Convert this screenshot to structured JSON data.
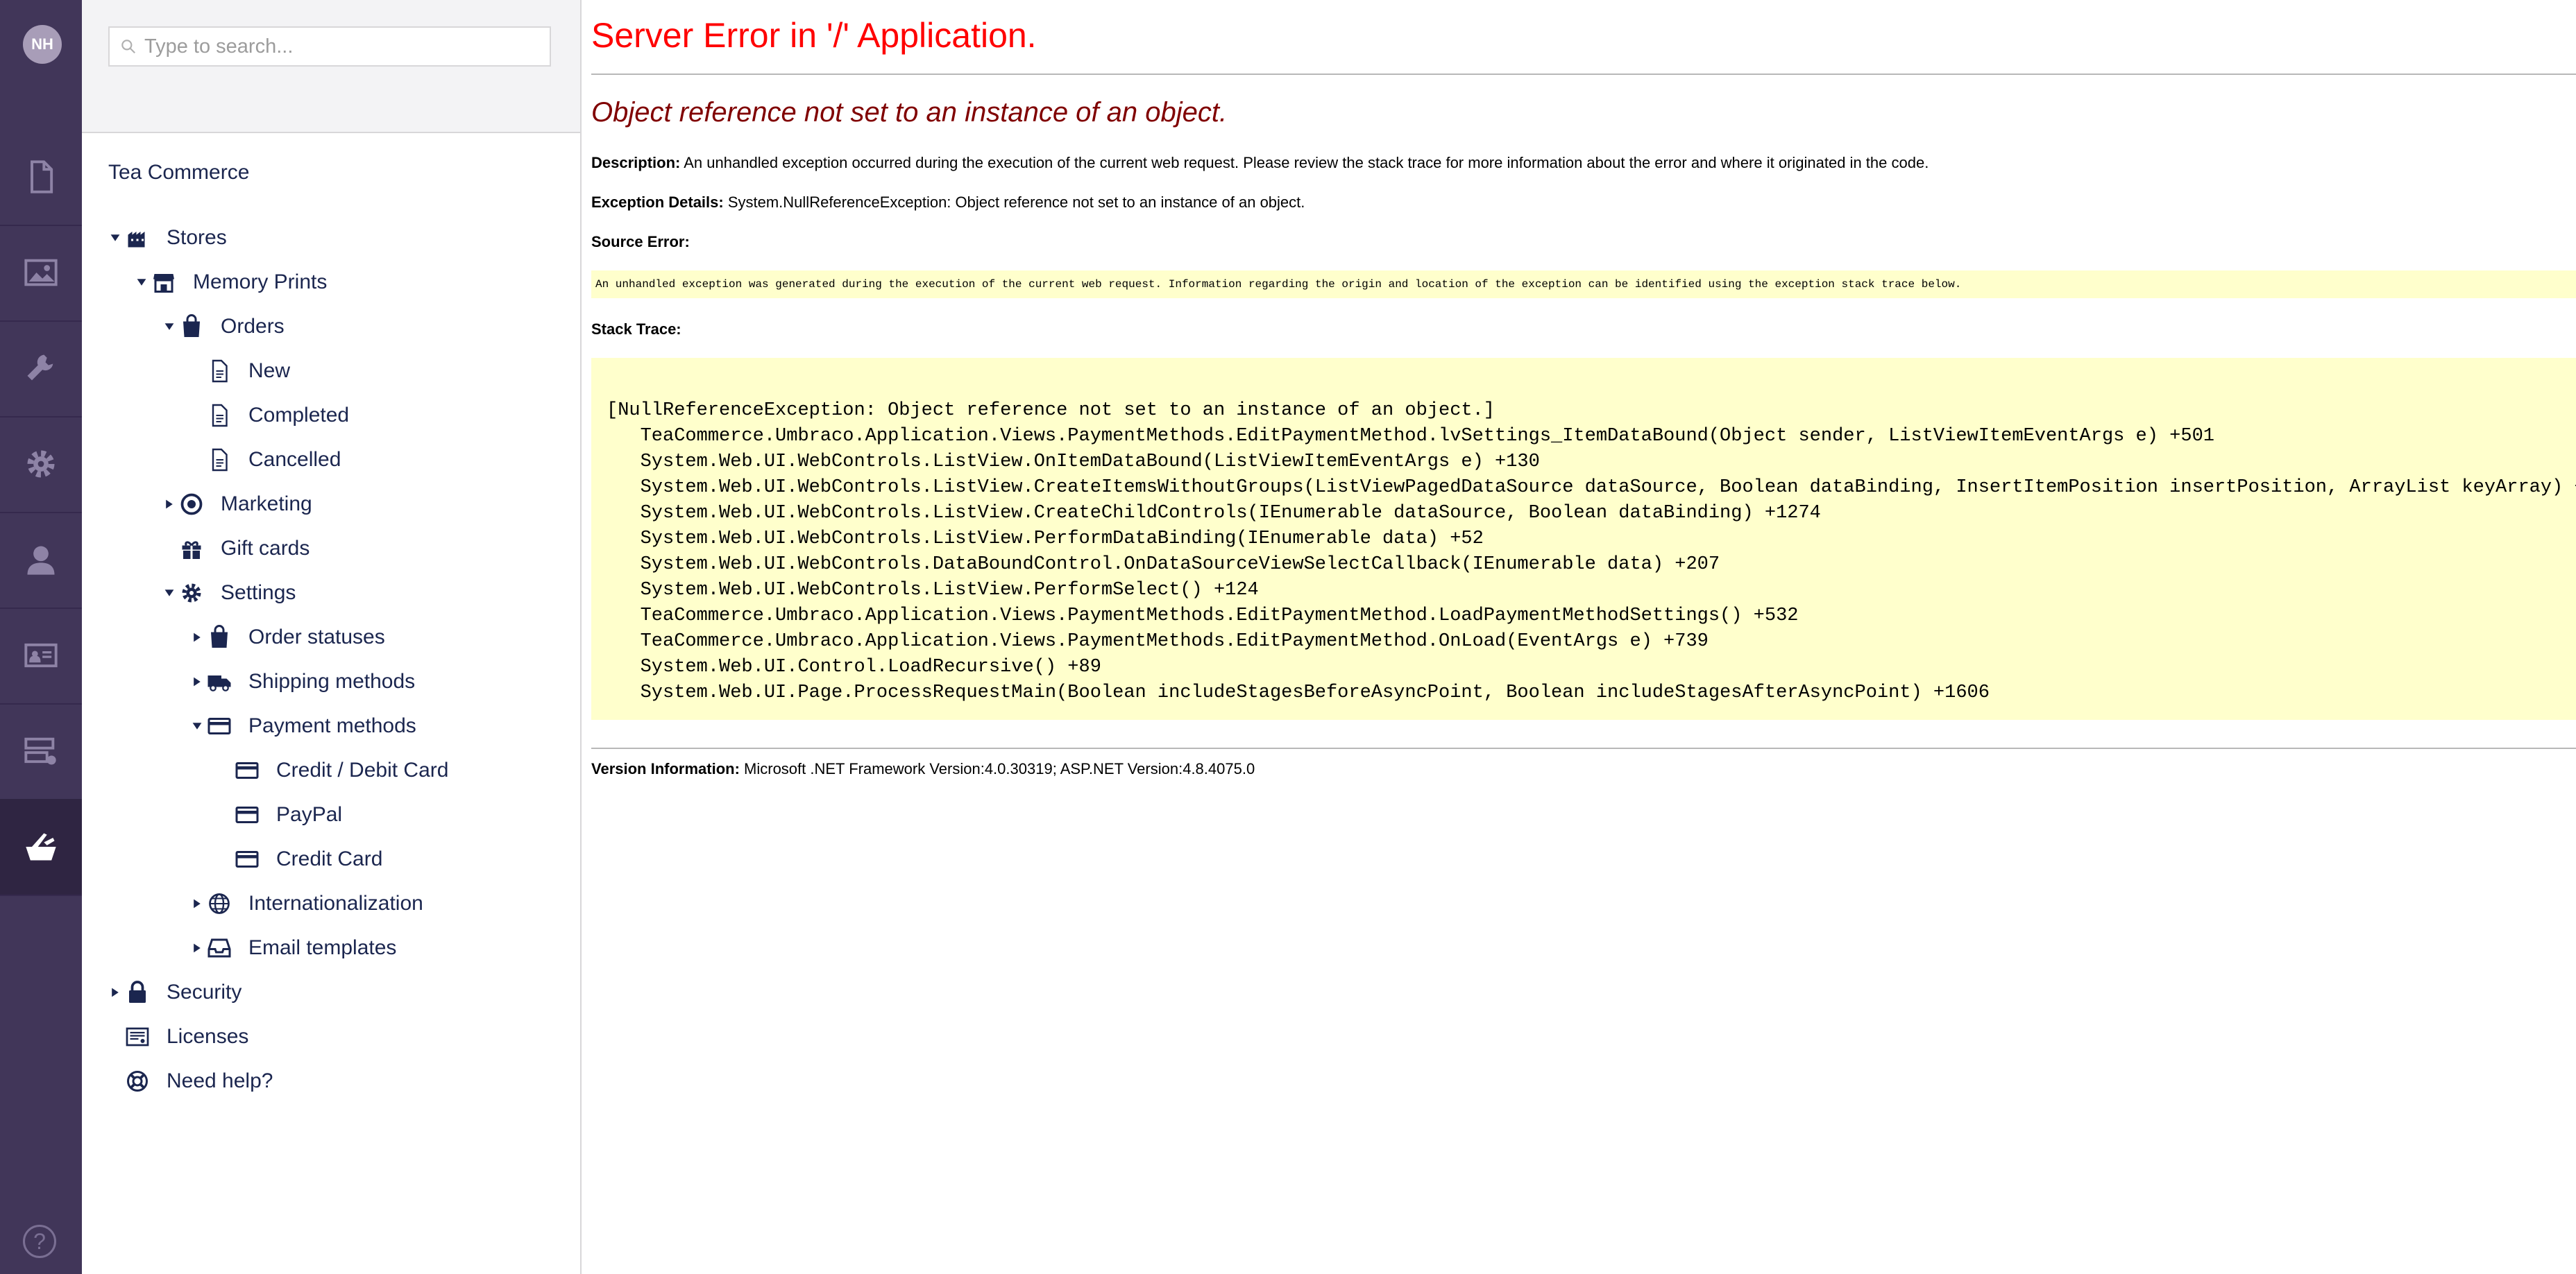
{
  "user": {
    "initials": "NH"
  },
  "rail": {
    "items": [
      "content-icon",
      "media-icon",
      "settings-wrench-icon",
      "gear-icon",
      "user-icon",
      "member-card-icon",
      "forms-icon",
      "tea-commerce-icon"
    ],
    "active": "tea-commerce-icon",
    "help_label": "?"
  },
  "search": {
    "placeholder": "Type to search..."
  },
  "tree": {
    "title": "Tea Commerce",
    "nodes": [
      {
        "label": "Stores",
        "icon": "stores-icon",
        "arrow": "expanded"
      },
      {
        "label": "Memory Prints",
        "icon": "store-icon",
        "arrow": "expanded"
      },
      {
        "label": "Orders",
        "icon": "shopping-bag-icon",
        "arrow": "expanded"
      },
      {
        "label": "New",
        "icon": "document-icon",
        "arrow": "none"
      },
      {
        "label": "Completed",
        "icon": "document-icon",
        "arrow": "none"
      },
      {
        "label": "Cancelled",
        "icon": "document-icon",
        "arrow": "none"
      },
      {
        "label": "Marketing",
        "icon": "target-icon",
        "arrow": "collapsed"
      },
      {
        "label": "Gift cards",
        "icon": "gift-icon",
        "arrow": "none"
      },
      {
        "label": "Settings",
        "icon": "gear-icon",
        "arrow": "expanded"
      },
      {
        "label": "Order statuses",
        "icon": "shopping-bag-icon",
        "arrow": "collapsed"
      },
      {
        "label": "Shipping methods",
        "icon": "truck-icon",
        "arrow": "collapsed"
      },
      {
        "label": "Payment methods",
        "icon": "credit-card-icon",
        "arrow": "expanded"
      },
      {
        "label": "Credit / Debit Card",
        "icon": "credit-card-icon",
        "arrow": "none"
      },
      {
        "label": "PayPal",
        "icon": "credit-card-icon",
        "arrow": "none"
      },
      {
        "label": "Credit Card",
        "icon": "credit-card-icon",
        "arrow": "none"
      },
      {
        "label": "Internationalization",
        "icon": "globe-icon",
        "arrow": "collapsed"
      },
      {
        "label": "Email templates",
        "icon": "inbox-icon",
        "arrow": "collapsed"
      },
      {
        "label": "Security",
        "icon": "lock-icon",
        "arrow": "collapsed"
      },
      {
        "label": "Licenses",
        "icon": "license-icon",
        "arrow": "none"
      },
      {
        "label": "Need help?",
        "icon": "lifebuoy-icon",
        "arrow": "none"
      }
    ]
  },
  "error": {
    "title": "Server Error in '/' Application.",
    "subtitle": "Object reference not set to an instance of an object.",
    "description_label": "Description:",
    "description_text": " An unhandled exception occurred during the execution of the current web request. Please review the stack trace for more information about the error and where it originated in the code.",
    "exception_label": "Exception Details:",
    "exception_text": " System.NullReferenceException: Object reference not set to an instance of an object.",
    "source_label": "Source Error:",
    "source_text": "An unhandled exception was generated during the execution of the current web request. Information regarding the origin and location of the exception can be identified using the exception stack trace below.",
    "stack_label": "Stack Trace:",
    "stack_lines": [
      "[NullReferenceException: Object reference not set to an instance of an object.]",
      "   TeaCommerce.Umbraco.Application.Views.PaymentMethods.EditPaymentMethod.lvSettings_ItemDataBound(Object sender, ListViewItemEventArgs e) +501",
      "   System.Web.UI.WebControls.ListView.OnItemDataBound(ListViewItemEventArgs e) +130",
      "   System.Web.UI.WebControls.ListView.CreateItemsWithoutGroups(ListViewPagedDataSource dataSource, Boolean dataBinding, InsertItemPosition insertPosition, ArrayList keyArray) +",
      "   System.Web.UI.WebControls.ListView.CreateChildControls(IEnumerable dataSource, Boolean dataBinding) +1274",
      "   System.Web.UI.WebControls.ListView.PerformDataBinding(IEnumerable data) +52",
      "   System.Web.UI.WebControls.DataBoundControl.OnDataSourceViewSelectCallback(IEnumerable data) +207",
      "   System.Web.UI.WebControls.ListView.PerformSelect() +124",
      "   TeaCommerce.Umbraco.Application.Views.PaymentMethods.EditPaymentMethod.LoadPaymentMethodSettings() +532",
      "   TeaCommerce.Umbraco.Application.Views.PaymentMethods.EditPaymentMethod.OnLoad(EventArgs e) +739",
      "   System.Web.UI.Control.LoadRecursive() +89",
      "   System.Web.UI.Page.ProcessRequestMain(Boolean includeStagesBeforeAsyncPoint, Boolean includeStagesAfterAsyncPoint) +1606"
    ],
    "version_label": "Version Information:",
    "version_text": " Microsoft .NET Framework Version:4.0.30319; ASP.NET Version:4.8.4075.0"
  },
  "colors": {
    "rail": "#413659",
    "error_title": "#ff0000",
    "error_subtitle": "#800000",
    "code_background": "#ffffcc"
  }
}
